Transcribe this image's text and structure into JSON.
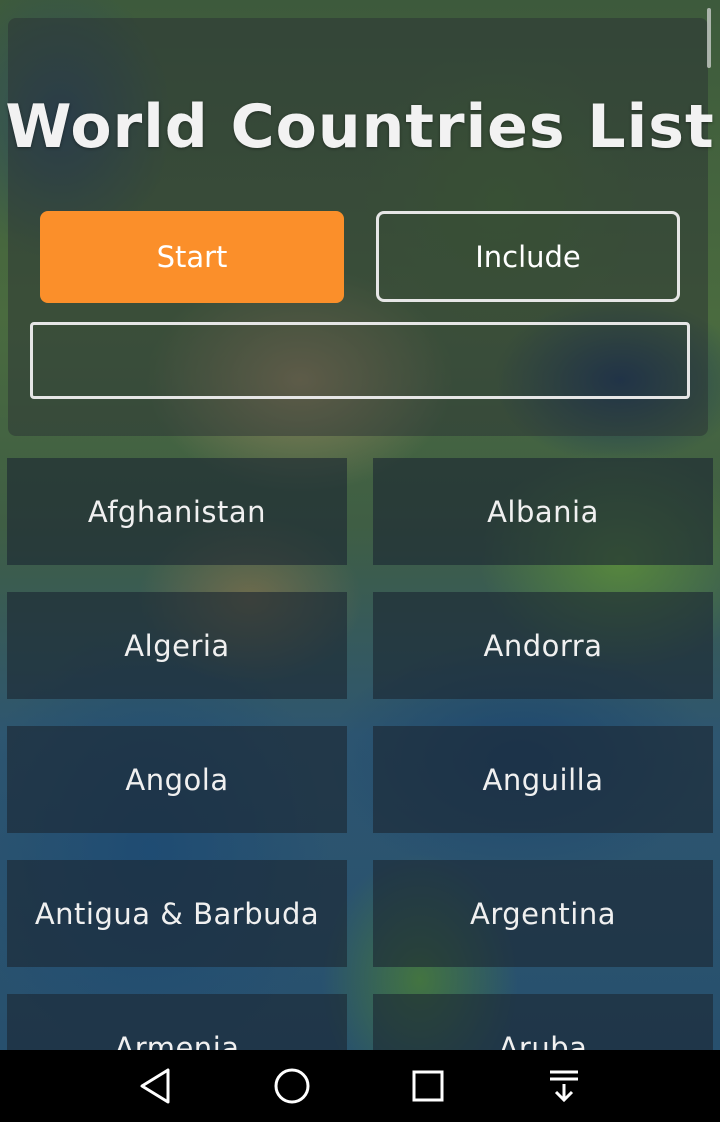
{
  "header": {
    "title": "World Countries List",
    "start_label": "Start",
    "include_label": "Include",
    "search_value": "",
    "search_placeholder": ""
  },
  "countries": [
    "Afghanistan",
    "Albania",
    "Algeria",
    "Andorra",
    "Angola",
    "Anguilla",
    "Antigua & Barbuda",
    "Argentina",
    "Armenia",
    "Aruba"
  ],
  "navbar": {
    "icons": [
      "back-icon",
      "home-icon",
      "recents-icon",
      "notifications-pull-icon"
    ]
  },
  "colors": {
    "accent": "#fb8f2a",
    "cell_background": "#1c2632",
    "navbar": "#000000"
  }
}
